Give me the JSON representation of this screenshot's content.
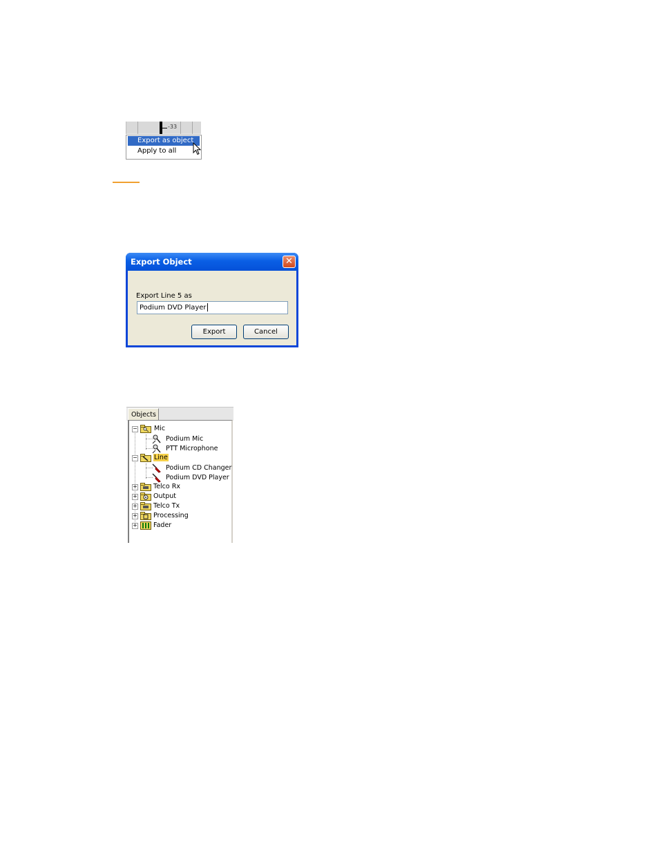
{
  "context_menu": {
    "meter_value": "-33",
    "items": [
      {
        "label": "Export as object",
        "selected": true
      },
      {
        "label": "Apply to all",
        "selected": false
      }
    ]
  },
  "dialog": {
    "title": "Export Object",
    "close_glyph": "✕",
    "prompt": "Export Line 5 as",
    "name_value": "Podium DVD Player",
    "export_label": "Export",
    "cancel_label": "Cancel"
  },
  "objects_panel": {
    "tab_label": "Objects",
    "tree": {
      "mic": {
        "label": "Mic",
        "children": [
          "Podium Mic",
          "PTT Microphone"
        ]
      },
      "line": {
        "label": "Line",
        "children": [
          "Podium CD Changer",
          "Podium DVD Player"
        ]
      },
      "telco_rx": "Telco Rx",
      "output": "Output",
      "telco_tx": "Telco Tx",
      "processing": "Processing",
      "fader": "Fader"
    },
    "highlight_color": "#f6d14a"
  },
  "colors": {
    "menu_selection": "#316ac5",
    "titlebar": "#0a5fe5",
    "accent_rule": "#f0a030"
  }
}
